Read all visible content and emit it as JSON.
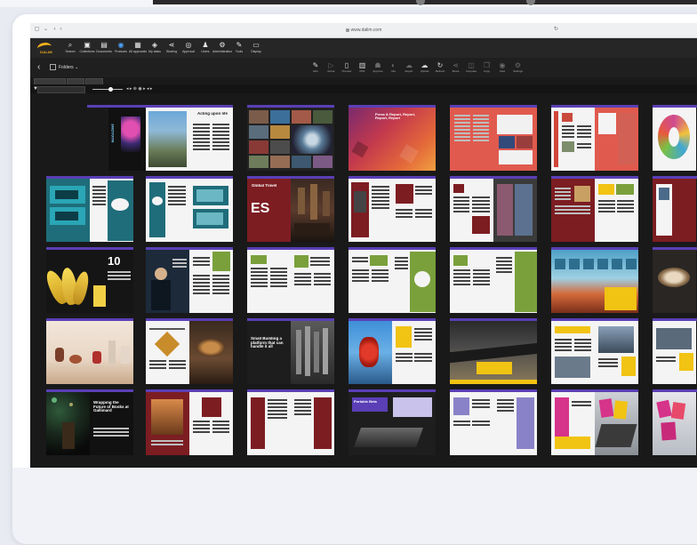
{
  "browser": {
    "url": "www.dalim.com"
  },
  "logo": {
    "text": "DALIM"
  },
  "toolbar": {
    "items": [
      {
        "label": "Search",
        "icon": "search-icon"
      },
      {
        "label": "Collections",
        "icon": "collections-icon"
      },
      {
        "label": "Documents",
        "icon": "documents-icon"
      },
      {
        "label": "Products",
        "icon": "products-icon",
        "active": true
      },
      {
        "label": "All approvals",
        "icon": "approvals-icon"
      },
      {
        "label": "My tasks",
        "icon": "tasks-icon"
      },
      {
        "label": "Sharing",
        "icon": "share-icon"
      },
      {
        "label": "Approval",
        "icon": "approval-icon"
      },
      {
        "label": "Users",
        "icon": "users-icon"
      },
      {
        "label": "Administration",
        "icon": "admin-icon"
      },
      {
        "label": "Tools",
        "icon": "tools-icon"
      },
      {
        "label": "Display",
        "icon": "display-icon"
      }
    ]
  },
  "secondary": {
    "folder": "Folders",
    "actions": [
      {
        "label": "Edit",
        "icon": "pen-icon",
        "dim": false
      },
      {
        "label": "Route",
        "icon": "route-icon",
        "dim": true
      },
      {
        "label": "Preview",
        "icon": "phone-icon",
        "dim": false
      },
      {
        "label": "PDF",
        "icon": "pdf-icon",
        "dim": false
      },
      {
        "label": "Approve",
        "icon": "approve-icon",
        "dim": true
      },
      {
        "label": "Info",
        "icon": "info-icon",
        "dim": true
      },
      {
        "label": "Export",
        "icon": "export-icon",
        "dim": true
      },
      {
        "label": "Upload",
        "icon": "upload-icon",
        "dim": false
      },
      {
        "label": "Refresh",
        "icon": "refresh-icon",
        "dim": false
      },
      {
        "label": "Share",
        "icon": "share2-icon",
        "dim": true
      },
      {
        "label": "Compare",
        "icon": "compare-icon",
        "dim": true
      },
      {
        "label": "Copy",
        "icon": "copy-icon",
        "dim": true
      },
      {
        "label": "View",
        "icon": "eye-icon",
        "dim": true
      },
      {
        "label": "Settings",
        "icon": "gear-icon",
        "dim": true
      }
    ]
  },
  "tabs": [
    "",
    "",
    ""
  ],
  "pages": {
    "p1_cover_title": "MAGAZINE",
    "p2_head": "Acting upon life",
    "p4_banner": "Press & Report, Report, Report, Report",
    "p9_head": "Global Travel",
    "p9_big": "ES",
    "p15_num": "10",
    "p24_head": "Small Building a platform that can handle it all",
    "p29_head": "Wrapping the Future of Books at Gallimard",
    "p33_head": "Portable Beta"
  },
  "colors": {
    "accent": "#5a3fb6",
    "page_white": "#f4f4f4",
    "teal": "#1f6d7a",
    "green": "#7aa03c",
    "maroon": "#7c1d22",
    "yellow": "#f1c313",
    "salmon": "#e05a4e",
    "dark_page": "#1d1d1d"
  }
}
